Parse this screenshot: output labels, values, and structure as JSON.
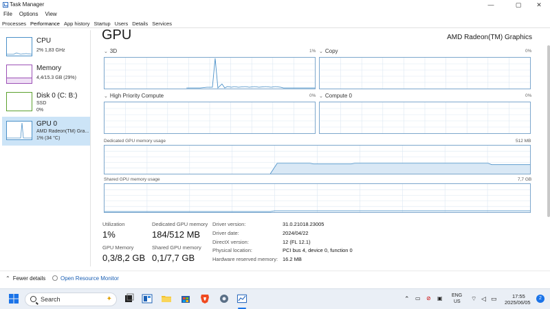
{
  "window": {
    "title": "Task Manager",
    "controls": {
      "minimize": "—",
      "maximize": "▢",
      "close": "✕"
    }
  },
  "menu": [
    "File",
    "Options",
    "View"
  ],
  "tabs": [
    "Processes",
    "Performance",
    "App history",
    "Startup",
    "Users",
    "Details",
    "Services"
  ],
  "sidebar": {
    "items": [
      {
        "title": "CPU",
        "line1": "2%  1,83 GHz",
        "line2": "",
        "color": "#4a90c8"
      },
      {
        "title": "Memory",
        "line1": "4,4/15.3 GB (29%)",
        "line2": "",
        "color": "#9b4fb5"
      },
      {
        "title": "Disk 0 (C: B:)",
        "line1": "SSD",
        "line2": "0%",
        "color": "#5aa02c"
      },
      {
        "title": "GPU 0",
        "line1": "AMD Radeon(TM) Gra...",
        "line2": "1% (34 °C)",
        "color": "#4a90c8"
      }
    ]
  },
  "main": {
    "title": "GPU",
    "gpu_name": "AMD Radeon(TM) Graphics",
    "graphs": [
      {
        "label": "3D",
        "pct": "1%"
      },
      {
        "label": "Copy",
        "pct": "0%"
      },
      {
        "label": "High Priority Compute",
        "pct": "0%"
      },
      {
        "label": "Compute 0",
        "pct": "0%"
      }
    ],
    "dedicated": {
      "label": "Dedicated GPU memory usage",
      "max": "512 MB"
    },
    "shared": {
      "label": "Shared GPU memory usage",
      "max": "7,7 GB"
    }
  },
  "stats": {
    "utilization": {
      "label": "Utilization",
      "value": "1%"
    },
    "dedicated_mem": {
      "label": "Dedicated GPU memory",
      "value": "184/512 MB"
    },
    "gpu_mem": {
      "label": "GPU Memory",
      "value": "0,3/8,2 GB"
    },
    "shared_mem": {
      "label": "Shared GPU memory",
      "value": "0,1/7,7 GB"
    }
  },
  "info": [
    {
      "label": "Driver version:",
      "value": "31.0.21018.23005"
    },
    {
      "label": "Driver date:",
      "value": "2024/04/22"
    },
    {
      "label": "DirectX version:",
      "value": "12 (FL 12.1)"
    },
    {
      "label": "Physical location:",
      "value": "PCI bus 4, device 0, function 0"
    },
    {
      "label": "Hardware reserved memory:",
      "value": "16.2 MB"
    }
  ],
  "footer": {
    "fewer_details": "Fewer details",
    "open_resmon": "Open Resource Monitor"
  },
  "taskbar": {
    "search_placeholder": "Search",
    "lang": "ENG",
    "region": "US",
    "time": "17:55",
    "date": "2025/06/05",
    "notifications": "2"
  }
}
